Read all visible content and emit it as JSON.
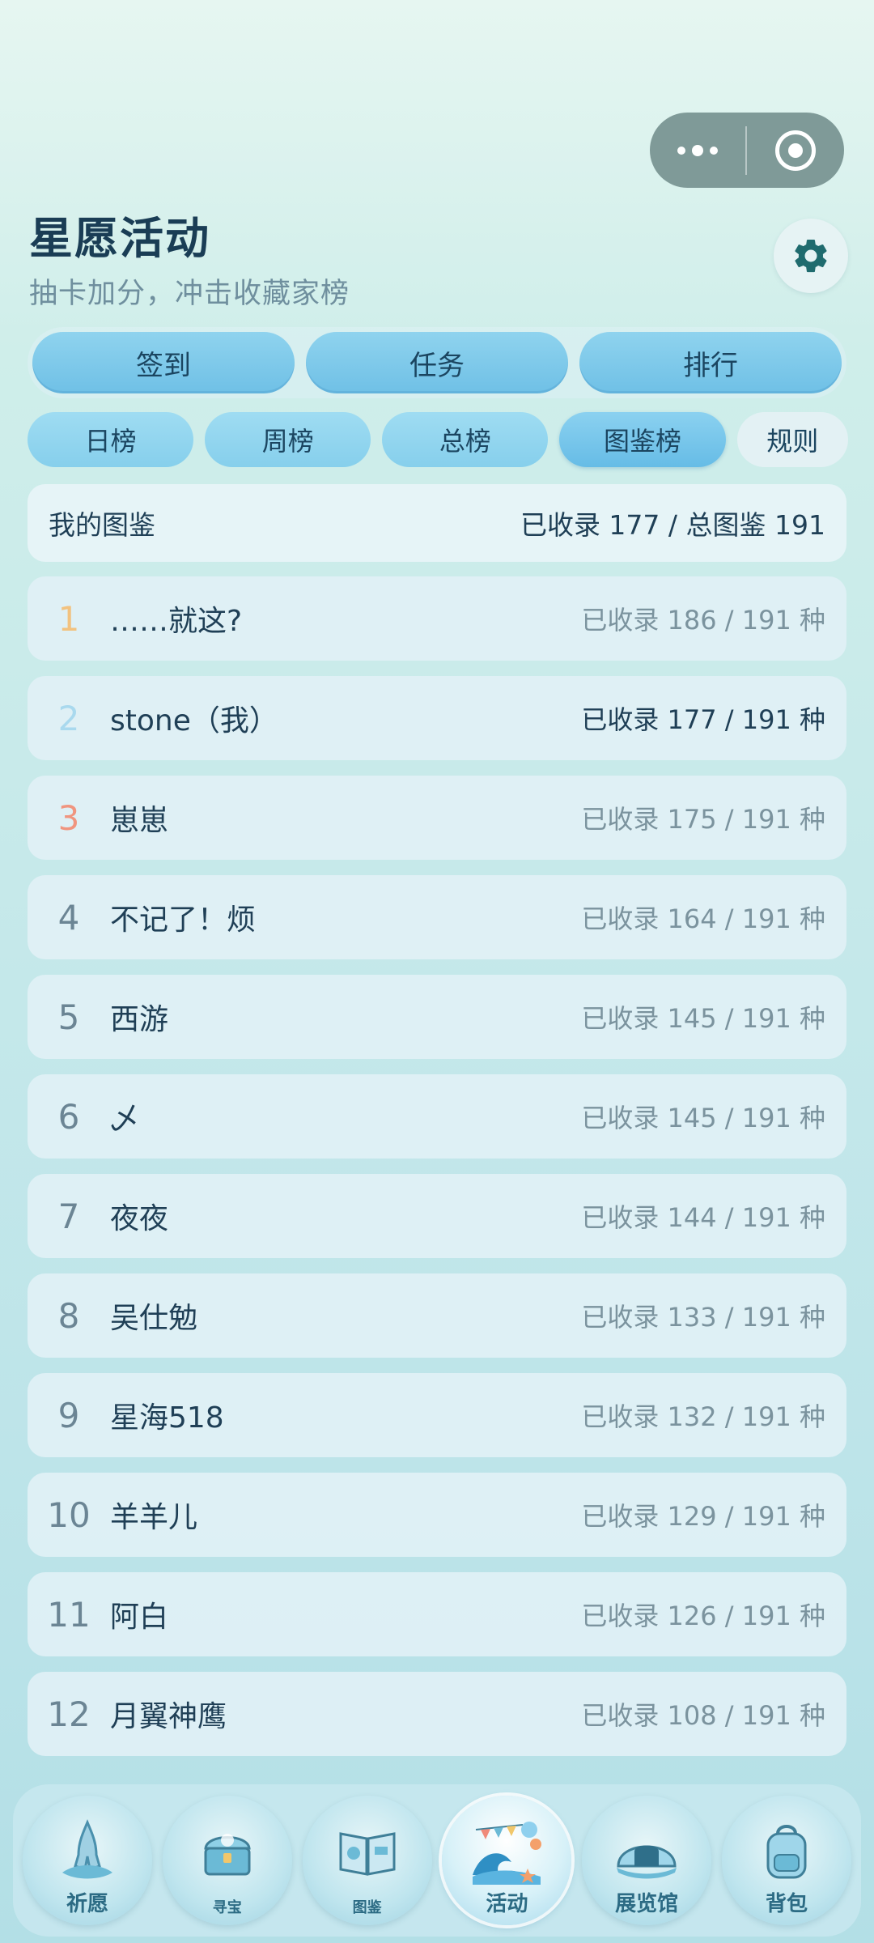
{
  "header": {
    "title": "星愿活动",
    "subtitle": "抽卡加分，冲击收藏家榜"
  },
  "main_tabs": [
    {
      "label": "签到"
    },
    {
      "label": "任务"
    },
    {
      "label": "排行"
    }
  ],
  "sub_tabs": [
    {
      "label": "日榜"
    },
    {
      "label": "周榜"
    },
    {
      "label": "总榜"
    },
    {
      "label": "图鉴榜"
    },
    {
      "label": "规则"
    }
  ],
  "summary": {
    "label": "我的图鉴",
    "value": "已收录 177 / 总图鉴 191"
  },
  "leaderboard": [
    {
      "rank": "1",
      "name": "……就这?",
      "stat": "已收录 186 / 191 种"
    },
    {
      "rank": "2",
      "name": "stone（我）",
      "stat": "已收录 177 / 191 种"
    },
    {
      "rank": "3",
      "name": "崽崽",
      "stat": "已收录 175 / 191 种"
    },
    {
      "rank": "4",
      "name": "不记了！烦",
      "stat": "已收录 164 / 191 种"
    },
    {
      "rank": "5",
      "name": "西游",
      "stat": "已收录 145 / 191 种"
    },
    {
      "rank": "6",
      "name": "乄",
      "stat": "已收录 145 / 191 种"
    },
    {
      "rank": "7",
      "name": "夜夜",
      "stat": "已收录 144 / 191 种"
    },
    {
      "rank": "8",
      "name": "吴仕勉",
      "stat": "已收录 133 / 191 种"
    },
    {
      "rank": "9",
      "name": "星海518",
      "stat": "已收录 132 / 191 种"
    },
    {
      "rank": "10",
      "name": "羊羊儿",
      "stat": "已收录 129 / 191 种"
    },
    {
      "rank": "11",
      "name": "阿白",
      "stat": "已收录 126 / 191 种"
    },
    {
      "rank": "12",
      "name": "月翼神鹰",
      "stat": "已收录 108 / 191 种"
    }
  ],
  "bottom_nav": [
    {
      "label": "祈愿",
      "icon": "praying-hands-icon"
    },
    {
      "label": "寻宝",
      "icon": "treasure-chest-icon"
    },
    {
      "label": "图鉴",
      "icon": "book-icon"
    },
    {
      "label": "活动",
      "icon": "wave-balloon-icon"
    },
    {
      "label": "展览馆",
      "icon": "shell-icon"
    },
    {
      "label": "背包",
      "icon": "backpack-icon"
    }
  ],
  "colors": {
    "accent": "#6fc0e6",
    "rank1": "#f2c27f",
    "rank2": "#a9d9ee",
    "rank3": "#f0957f"
  }
}
